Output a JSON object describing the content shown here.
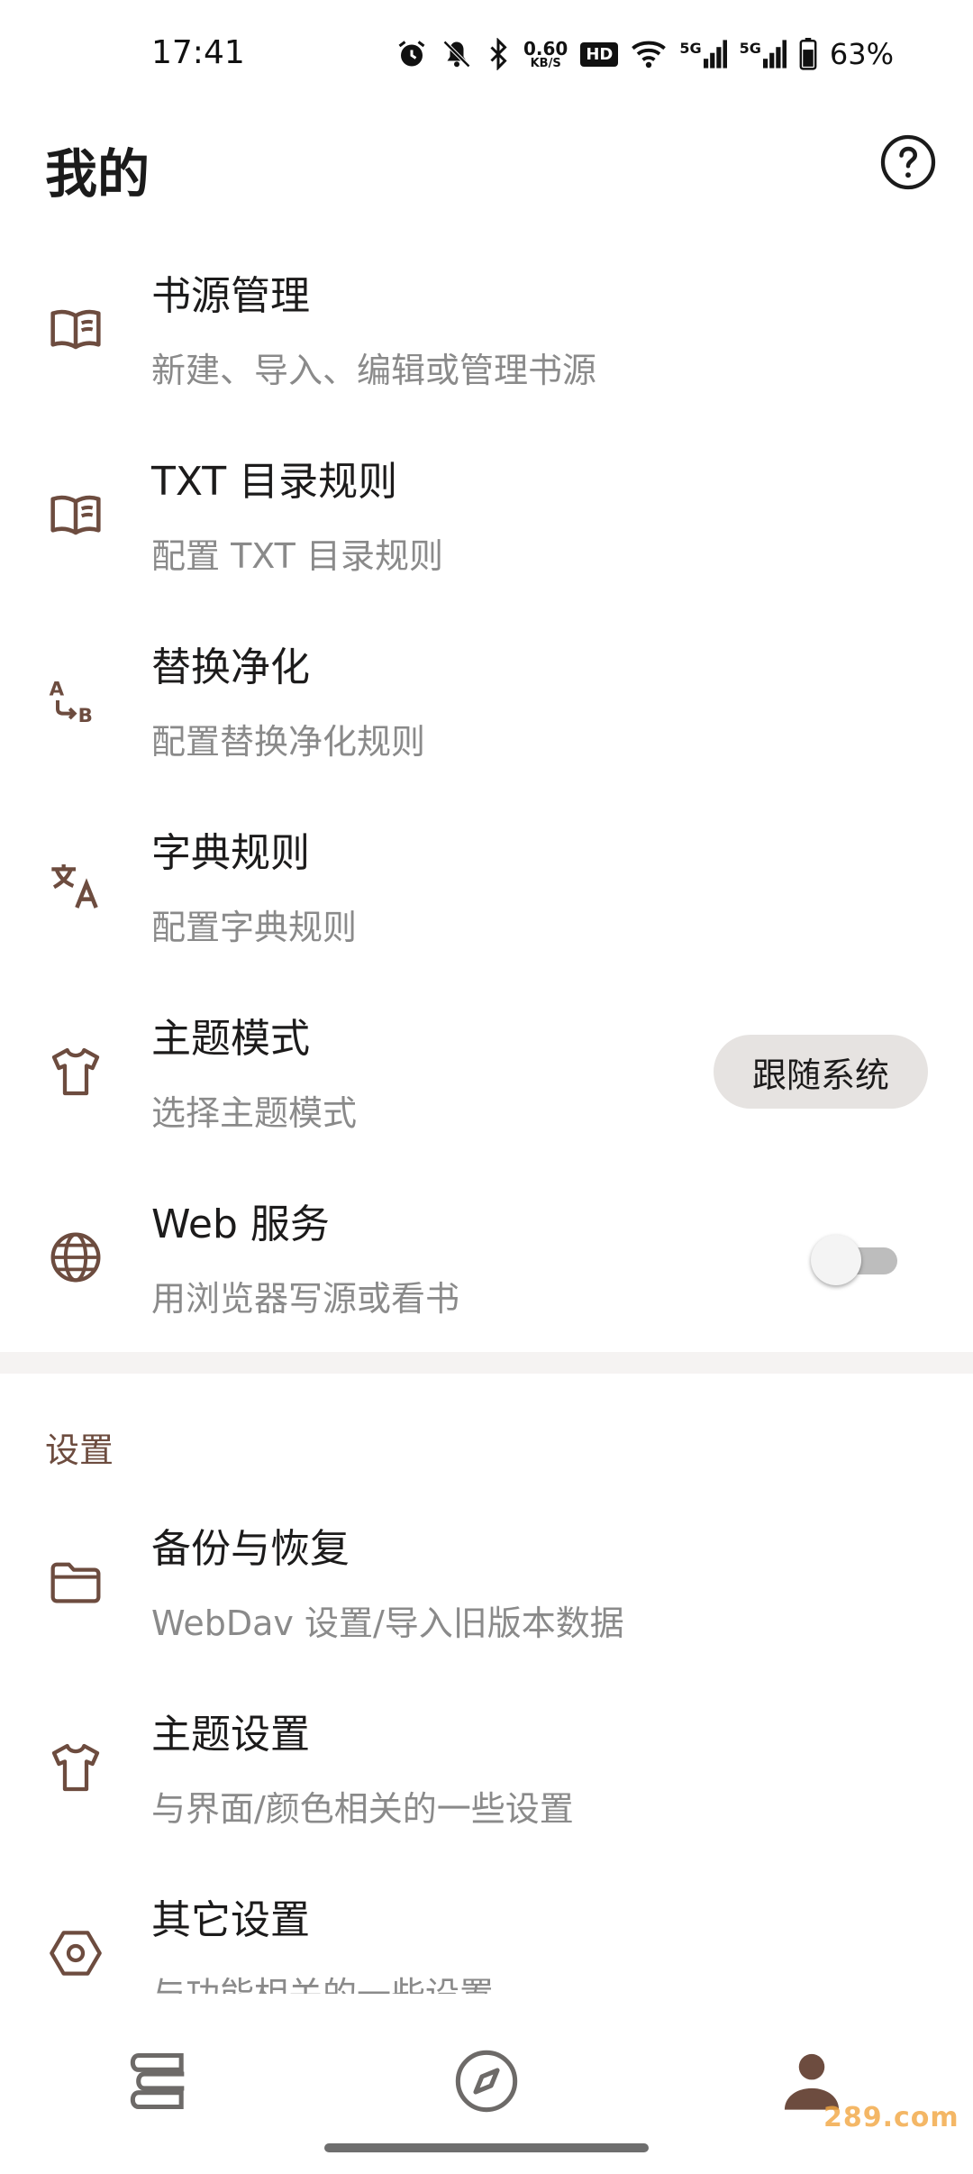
{
  "status_bar": {
    "time": "17:41",
    "net_speed_value": "0.60",
    "net_speed_unit": "KB/S",
    "hd_label": "HD",
    "network_5g": "5G",
    "battery_percent": "63%",
    "icons": [
      "alarm-icon",
      "mute-bell-icon",
      "bluetooth-icon",
      "wifi-icon",
      "signal-icon",
      "battery-icon"
    ]
  },
  "header": {
    "title": "我的",
    "help_icon": "help-circle-icon"
  },
  "items": [
    {
      "icon": "book-icon",
      "title": "书源管理",
      "subtitle": "新建、导入、编辑或管理书源"
    },
    {
      "icon": "book-icon",
      "title": "TXT 目录规则",
      "subtitle": "配置 TXT 目录规则"
    },
    {
      "icon": "find-replace-icon",
      "title": "替换净化",
      "subtitle": "配置替换净化规则"
    },
    {
      "icon": "translate-icon",
      "title": "字典规则",
      "subtitle": "配置字典规则"
    },
    {
      "icon": "shirt-icon",
      "title": "主题模式",
      "subtitle": "选择主题模式",
      "chip": "跟随系统"
    },
    {
      "icon": "globe-icon",
      "title": "Web 服务",
      "subtitle": "用浏览器写源或看书",
      "switch_on": false
    }
  ],
  "settings_section": {
    "label": "设置",
    "items": [
      {
        "icon": "folder-icon",
        "title": "备份与恢复",
        "subtitle": "WebDav 设置/导入旧版本数据"
      },
      {
        "icon": "shirt-icon",
        "title": "主题设置",
        "subtitle": "与界面/颜色相关的一些设置"
      },
      {
        "icon": "hexagon-settings-icon",
        "title": "其它设置",
        "subtitle": "与功能相关的一些设置"
      }
    ]
  },
  "bottom_nav": [
    {
      "icon": "bookshelf-icon",
      "active": false
    },
    {
      "icon": "compass-icon",
      "active": false
    },
    {
      "icon": "person-icon",
      "active": true
    }
  ],
  "watermark": "289.com",
  "colors": {
    "accent": "#6d4c3f",
    "secondary_text": "#8a8a8a",
    "chip_bg": "#e6e3e1"
  }
}
